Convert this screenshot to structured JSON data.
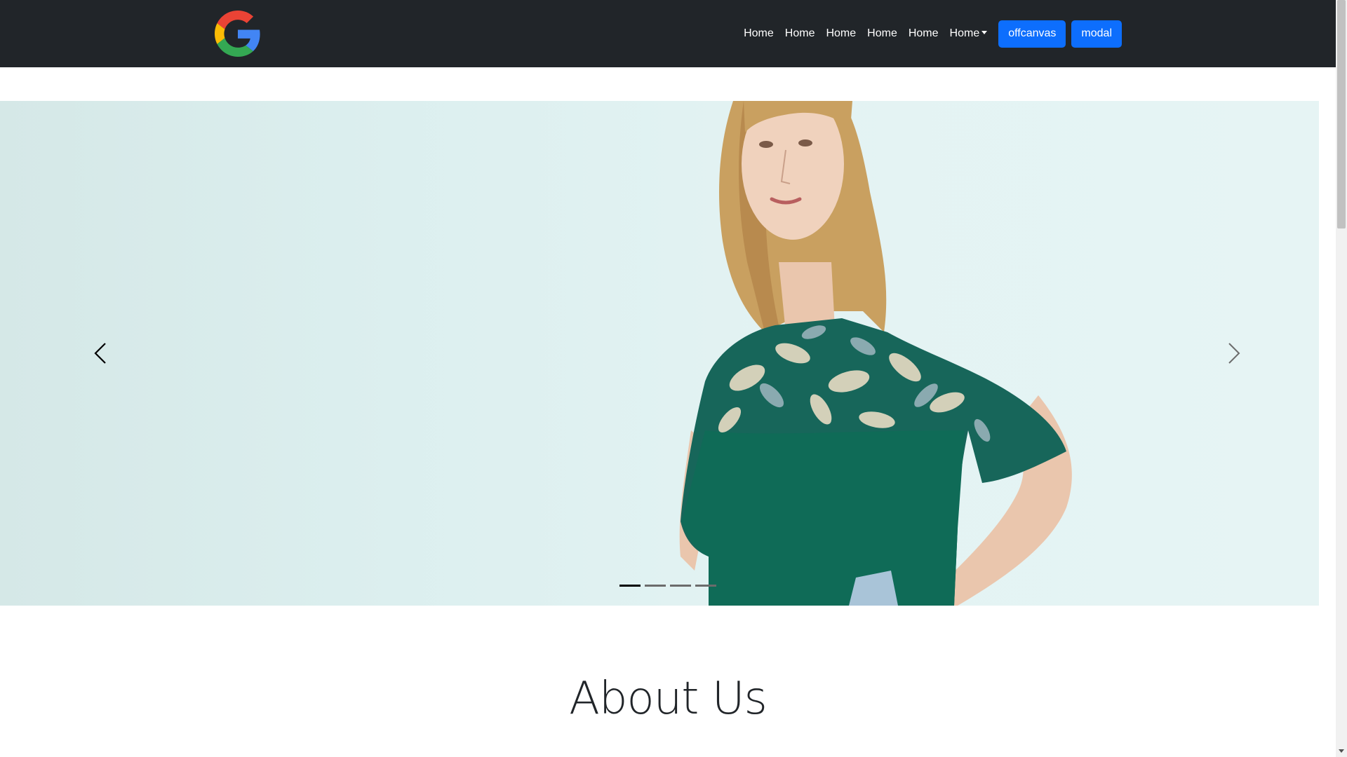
{
  "navbar": {
    "logo_icon": "google-g-logo-icon",
    "links": [
      {
        "label": "Home"
      },
      {
        "label": "Home"
      },
      {
        "label": "Home"
      },
      {
        "label": "Home"
      },
      {
        "label": "Home"
      }
    ],
    "dropdown": {
      "label": "Home",
      "icon": "caret-down-icon"
    },
    "buttons": {
      "offcanvas": "offcanvas",
      "modal": "modal"
    },
    "colors": {
      "background": "#212529",
      "button": "#0d6efd"
    }
  },
  "carousel": {
    "prev_icon": "chevron-left-icon",
    "next_icon": "chevron-right-icon",
    "slide_count": 4,
    "active_index": 0
  },
  "about": {
    "title": "About Us"
  }
}
